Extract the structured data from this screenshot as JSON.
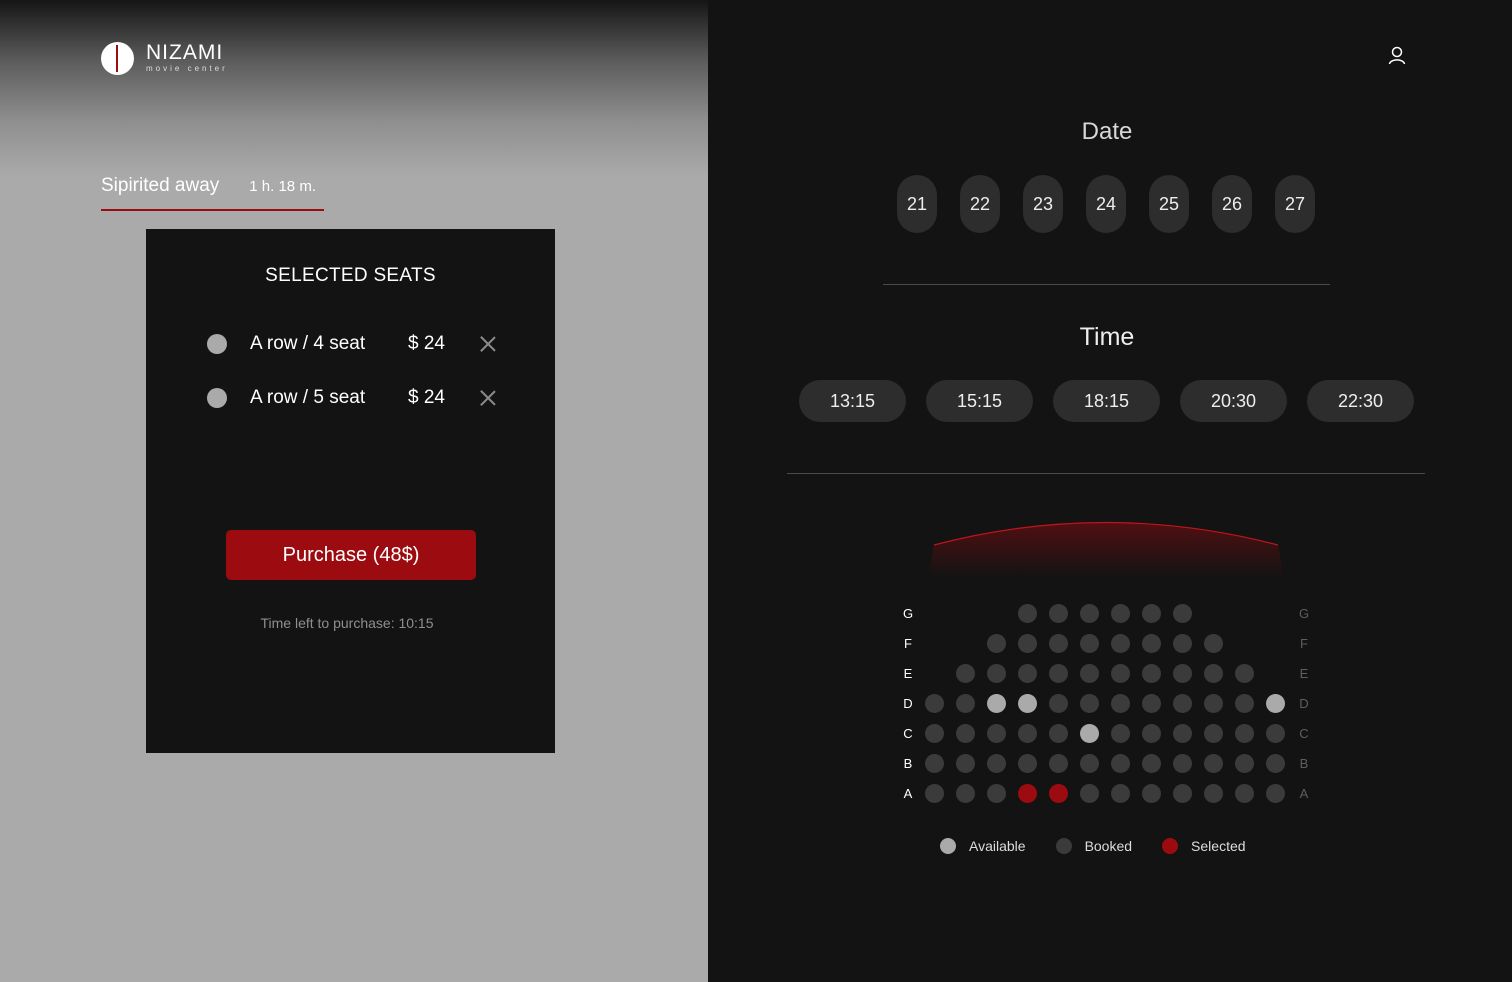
{
  "brand": {
    "name": "NIZAMI",
    "subtitle": "movie center"
  },
  "movie": {
    "title": "Sipirited away",
    "duration": "1 h. 18 m."
  },
  "selected_seats": {
    "title": "SELECTED SEATS",
    "items": [
      {
        "label": "A row / 4 seat",
        "price": "$ 24"
      },
      {
        "label": "A row / 5 seat",
        "price": "$ 24"
      }
    ],
    "purchase_label": "Purchase (48$)",
    "time_left": "Time left to purchase: 10:15"
  },
  "date": {
    "title": "Date",
    "days": [
      "21",
      "22",
      "23",
      "24",
      "25",
      "26",
      "27"
    ]
  },
  "time": {
    "title": "Time",
    "slots": [
      "13:15",
      "15:15",
      "18:15",
      "20:30",
      "22:30"
    ]
  },
  "seat_map": {
    "colors": {
      "available": "#aaaaaa",
      "booked": "#3b3b3b",
      "selected": "#9b0b10"
    },
    "rows": [
      {
        "label": "G",
        "seats": [
          null,
          null,
          null,
          "b",
          "b",
          "b",
          "b",
          "b",
          "b",
          null,
          null,
          null
        ]
      },
      {
        "label": "F",
        "seats": [
          null,
          null,
          "b",
          "b",
          "b",
          "b",
          "b",
          "b",
          "b",
          "b",
          null,
          null
        ]
      },
      {
        "label": "E",
        "seats": [
          null,
          "b",
          "b",
          "b",
          "b",
          "b",
          "b",
          "b",
          "b",
          "b",
          "b",
          null
        ]
      },
      {
        "label": "D",
        "seats": [
          "b",
          "b",
          "a",
          "a",
          "b",
          "b",
          "b",
          "b",
          "b",
          "b",
          "b",
          "a"
        ]
      },
      {
        "label": "C",
        "seats": [
          "b",
          "b",
          "b",
          "b",
          "b",
          "a",
          "b",
          "b",
          "b",
          "b",
          "b",
          "b"
        ]
      },
      {
        "label": "B",
        "seats": [
          "b",
          "b",
          "b",
          "b",
          "b",
          "b",
          "b",
          "b",
          "b",
          "b",
          "b",
          "b"
        ]
      },
      {
        "label": "A",
        "seats": [
          "b",
          "b",
          "b",
          "s",
          "s",
          "b",
          "b",
          "b",
          "b",
          "b",
          "b",
          "b"
        ]
      }
    ]
  },
  "legend": {
    "available": "Available",
    "booked": "Booked",
    "selected": "Selected"
  }
}
